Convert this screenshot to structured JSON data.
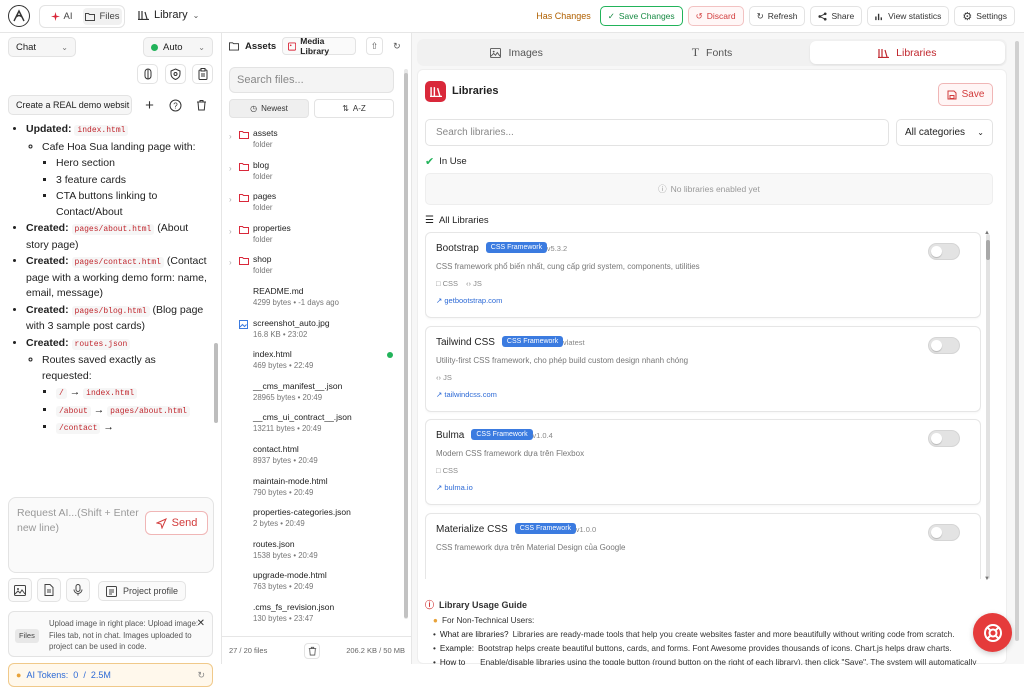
{
  "topbar": {
    "logo_icon": "logo-icon",
    "mode_tabs": [
      {
        "label": "AI",
        "icon": "sparkle-icon"
      },
      {
        "label": "Files",
        "icon": "folder-icon"
      }
    ],
    "library_label": "Library",
    "has_changes": "Has Changes",
    "buttons": [
      {
        "label": "Save Changes",
        "icon": "check-icon"
      },
      {
        "label": "Discard",
        "icon": "discard-icon"
      },
      {
        "label": "Refresh",
        "icon": "refresh-icon"
      },
      {
        "label": "Share",
        "icon": "share-icon"
      },
      {
        "label": "View statistics",
        "icon": "stats-icon"
      },
      {
        "label": "Settings",
        "icon": "gear-icon"
      }
    ]
  },
  "chat": {
    "mode": "Chat",
    "model": "Auto",
    "project": "Create a REAL demo websit",
    "messages": {
      "updated_label": "Updated:",
      "updated_file": "index.html",
      "landing": "Cafe Hoa Sua landing page with:",
      "landing_items": [
        "Hero section",
        "3 feature cards",
        "CTA buttons linking to Contact/About"
      ],
      "created_label": "Created:",
      "about_file": "pages/about.html",
      "about_desc": "(About story page)",
      "contact_file": "pages/contact.html",
      "contact_desc": "(Contact page with a working demo form: name, email, message)",
      "blog_file": "pages/blog.html",
      "blog_desc": "(Blog page with 3 sample post cards)",
      "routes_file": "routes.json",
      "routes_desc": "Routes saved exactly as requested:",
      "routes": [
        {
          "from": "/",
          "arrow": "→",
          "to": "index.html"
        },
        {
          "from": "/about",
          "arrow": "→",
          "to": "pages/about.html"
        },
        {
          "from": "/contact",
          "arrow": "→",
          "to": ""
        }
      ]
    },
    "input_placeholder": "Request AI...(Shift + Enter new line)",
    "send_label": "Send",
    "profile_label": "Project profile",
    "info_badge": "Files",
    "info_text": "Upload image in right place: Upload image: Files tab, not in chat. Images uploaded to project can be used in code.",
    "tokens_label": "AI Tokens:",
    "tokens_used": "0",
    "tokens_sep": "/",
    "tokens_total": "2.5M"
  },
  "files": {
    "title": "Assets",
    "media_library": "Media Library",
    "search_placeholder": "Search files...",
    "sort_newest": "Newest",
    "sort_az": "A-Z",
    "items": [
      {
        "name": "assets",
        "meta": "folder",
        "type": "folder"
      },
      {
        "name": "blog",
        "meta": "folder",
        "type": "folder"
      },
      {
        "name": "pages",
        "meta": "folder",
        "type": "folder"
      },
      {
        "name": "properties",
        "meta": "folder",
        "type": "folder"
      },
      {
        "name": "shop",
        "meta": "folder",
        "type": "folder"
      },
      {
        "name": "README.md",
        "meta": "4299 bytes • -1 days ago",
        "type": "file"
      },
      {
        "name": "screenshot_auto.jpg",
        "meta": "16.8 KB • 23:02",
        "type": "image"
      },
      {
        "name": "index.html",
        "meta": "469 bytes • 22:49",
        "type": "file",
        "active": true
      },
      {
        "name": "__cms_manifest__.json",
        "meta": "28965 bytes • 20:49",
        "type": "file"
      },
      {
        "name": "__cms_ui_contract__.json",
        "meta": "13211 bytes • 20:49",
        "type": "file"
      },
      {
        "name": "contact.html",
        "meta": "8937 bytes • 20:49",
        "type": "file"
      },
      {
        "name": "maintain-mode.html",
        "meta": "790 bytes • 20:49",
        "type": "file"
      },
      {
        "name": "properties-categories.json",
        "meta": "2 bytes • 20:49",
        "type": "file"
      },
      {
        "name": "routes.json",
        "meta": "1538 bytes • 20:49",
        "type": "file"
      },
      {
        "name": "upgrade-mode.html",
        "meta": "763 bytes • 20:49",
        "type": "file"
      },
      {
        "name": ".cms_fs_revision.json",
        "meta": "130 bytes • 23:47",
        "type": "file"
      }
    ],
    "count": "27 / 20 files",
    "size": "206.2 KB / 50 MB"
  },
  "libraries": {
    "tabs": [
      {
        "label": "Images",
        "icon": "image-icon"
      },
      {
        "label": "Fonts",
        "icon": "font-icon"
      },
      {
        "label": "Libraries",
        "icon": "library-icon",
        "active": true
      }
    ],
    "title": "Libraries",
    "save_label": "Save",
    "search_placeholder": "Search libraries...",
    "category": "All categories",
    "in_use_label": "In Use",
    "empty_label": "No libraries enabled yet",
    "all_label": "All Libraries",
    "items": [
      {
        "name": "Bootstrap",
        "tag": "CSS Framework",
        "version": "v5.3.2",
        "desc": "CSS framework phổ biến nhất, cung cấp grid system, components, utilities",
        "types": [
          "CSS",
          "JS"
        ],
        "url": "getbootstrap.com",
        "enabled": false
      },
      {
        "name": "Tailwind CSS",
        "tag": "CSS Framework",
        "version": "vlatest",
        "desc": "Utility-first CSS framework, cho phép build custom design nhanh chóng",
        "types": [
          "JS"
        ],
        "url": "tailwindcss.com",
        "enabled": false
      },
      {
        "name": "Bulma",
        "tag": "CSS Framework",
        "version": "v1.0.4",
        "desc": "Modern CSS framework dựa trên Flexbox",
        "types": [
          "CSS"
        ],
        "url": "bulma.io",
        "enabled": false
      },
      {
        "name": "Materialize CSS",
        "tag": "CSS Framework",
        "version": "v1.0.0",
        "desc": "CSS framework dựa trên Material Design của Google",
        "types": [],
        "url": "",
        "enabled": false
      }
    ],
    "guide": {
      "title": "Library Usage Guide",
      "subtitle": "For Non-Technical Users:",
      "rows": [
        {
          "label": "What are libraries?",
          "text": "Libraries are ready-made tools that help you create websites faster and more beautifully without writing code from scratch."
        },
        {
          "label": "Example:",
          "text": "Bootstrap helps create beautiful buttons, cards, and forms. Font Awesome provides thousands of icons. Chart.js helps draw charts."
        },
        {
          "label": "How to use:",
          "text": "Enable/disable libraries using the toggle button (round button on the right of each library), then click \"Save\". The system will automatically load libraries into your website."
        }
      ]
    }
  },
  "colors": {
    "accent": "#d9283a",
    "green": "#22b35a",
    "blue": "#3b7be0",
    "link": "#2d6ad6"
  }
}
